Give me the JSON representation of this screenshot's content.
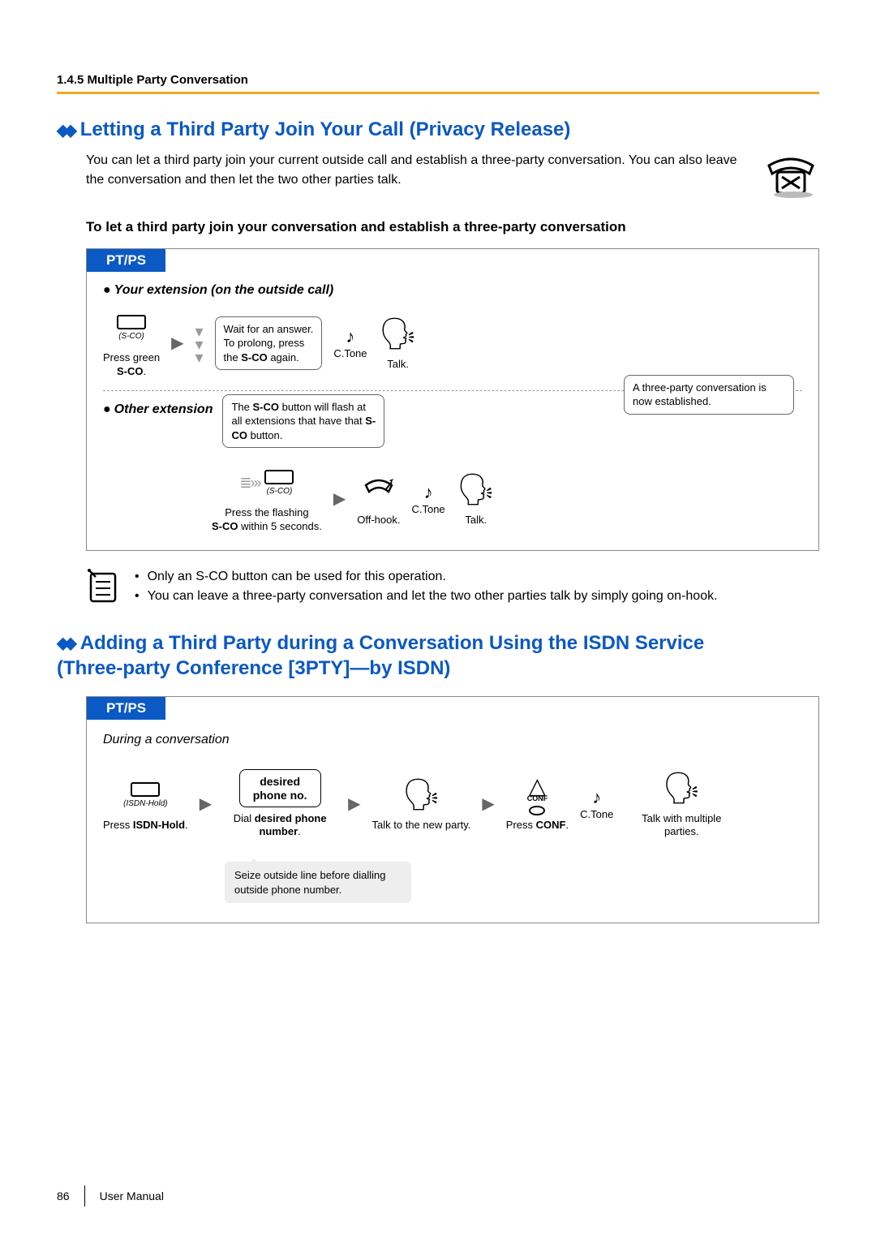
{
  "breadcrumb": "1.4.5 Multiple Party Conversation",
  "section1": {
    "title": "Letting a Third Party Join Your Call (Privacy Release)",
    "intro": "You can let a third party join your current outside call and establish a three-party conversation. You can also leave the conversation and then let the two other parties talk.",
    "sub_heading": "To let a third party join your conversation and establish a three-party conversation",
    "tab": "PT/PS",
    "your_ext_label": "Your extension (on the outside call)",
    "btn_sco": "(S-CO)",
    "press_green_sco": "Press green",
    "sco_bold": "S-CO",
    "wait_bubble_l1": "Wait for an answer.",
    "wait_bubble_l2": "To prolong, press",
    "wait_bubble_l3_pre": "the ",
    "wait_bubble_l3_b": "S-CO",
    "wait_bubble_l3_post": " again.",
    "ctone": "C.Tone",
    "talk": "Talk.",
    "flash_bubble_pre": "The ",
    "flash_bubble_b1": "S-CO",
    "flash_bubble_mid": " button will flash at all extensions that have that ",
    "flash_bubble_b2": "S-CO",
    "flash_bubble_post": " button.",
    "side_bubble": "A three-party conversation is now established.",
    "other_ext_label": "Other extension",
    "press_flashing_pre": "Press the flashing",
    "press_flashing_b": "S-CO",
    "press_flashing_post": " within 5 seconds.",
    "offhook": "Off-hook."
  },
  "notes": {
    "n1": "Only an S-CO button can be used for this operation.",
    "n2": "You can leave a three-party conversation and let the two other parties talk by simply going on-hook."
  },
  "section2": {
    "title_line1": "Adding a Third Party during a Conversation Using the ISDN Service",
    "title_line2": "(Three-party Conference [3PTY]—by ISDN)",
    "tab": "PT/PS",
    "during": "During a conversation",
    "isdn_hold": "(ISDN-Hold)",
    "press_isdn_pre": "Press ",
    "press_isdn_b": "ISDN-Hold",
    "desired": "desired",
    "phone_no": "phone no.",
    "dial_pre": "Dial ",
    "dial_b": "desired phone number",
    "talk_new": "Talk to the new party.",
    "conf_label": "CONF",
    "press_conf_pre": "Press ",
    "press_conf_b": "CONF",
    "ctone": "C.Tone",
    "talk_multi": "Talk with multiple parties.",
    "seize_note": "Seize outside line before dialling outside phone number."
  },
  "footer": {
    "page": "86",
    "label": "User Manual"
  }
}
